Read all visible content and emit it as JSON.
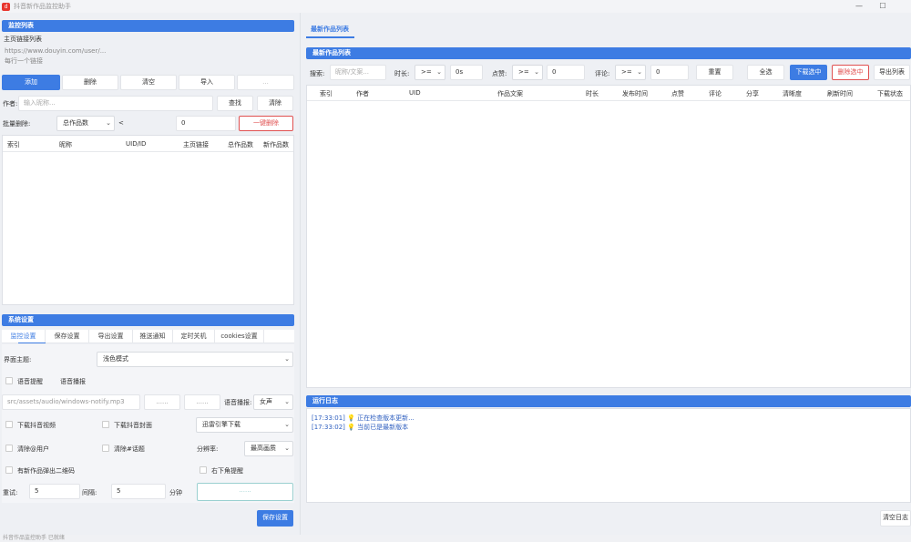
{
  "window": {
    "title": "抖音新作品监控助手",
    "minimize_icon": "minimize-icon",
    "maximize_icon": "maximize-icon"
  },
  "monitor": {
    "header": "监控列表",
    "homepage_label": "主页链接列表",
    "homepage_placeholder_line1": "https://www.douyin.com/user/...",
    "homepage_placeholder_line2": "每行一个链接",
    "buttons": {
      "add": "添加",
      "delete": "删除",
      "clear": "清空",
      "import": "导入",
      "extra": "..."
    },
    "author_label": "作者:",
    "author_placeholder": "输入昵称...",
    "find_button": "查找",
    "clear_button": "清除",
    "batch_label": "批量删除:",
    "batch_select": "总作品数",
    "batch_op": "<",
    "batch_value": "0",
    "batch_delete_button": "一键删除",
    "columns": [
      "索引",
      "昵称",
      "UID/ID",
      "主页链接",
      "总作品数",
      "新作品数"
    ]
  },
  "settings": {
    "header": "系统设置",
    "tabs": [
      "监控设置",
      "保存设置",
      "导出设置",
      "推送通知",
      "定时关机",
      "cookies设置"
    ],
    "theme_label": "界面主题:",
    "theme_value": "浅色模式",
    "voice_alert": "语音提醒",
    "voice_setting": "语音播报",
    "audio_path": "src/assets/audio/windows-notify.mp3",
    "audio_btn1": "......",
    "audio_btn2": "......",
    "voice_label": "语音播报:",
    "voice_value": "女声",
    "download_video": "下载抖音视频",
    "download_cover": "下载抖音封面",
    "engine_value": "迅雷引擎下载",
    "remove_at": "清除@用户",
    "remove_topic": "清除#话题",
    "resolution_label": "分辨率:",
    "resolution_value": "最高画质",
    "qr_popup": "有新作品弹出二维码",
    "corner_popup": "右下角提醒",
    "retry_label": "重试:",
    "retry_value": "5",
    "interval_label": "间隔:",
    "interval_value": "5",
    "minute_label": "分钟",
    "progress_text": "......",
    "save_button": "保存设置"
  },
  "works": {
    "tab": "最新作品列表",
    "header": "最新作品列表",
    "search_label": "搜索:",
    "search_placeholder": "昵称/文案...",
    "duration_label": "时长:",
    "duration_op": ">=",
    "duration_value": "0s",
    "likes_label": "点赞:",
    "likes_op": ">=",
    "likes_value": "0",
    "comments_label": "评论:",
    "comments_op": ">=",
    "comments_value": "0",
    "reset_button": "重置",
    "select_all_button": "全选",
    "download_selected_button": "下载选中",
    "delete_selected_button": "删除选中",
    "export_button": "导出列表",
    "columns": [
      "索引",
      "作者",
      "UID",
      "作品文案",
      "时长",
      "发布时间",
      "点赞",
      "评论",
      "分享",
      "清晰度",
      "刷新时间",
      "下载状态"
    ]
  },
  "log": {
    "header": "运行日志",
    "lines": [
      {
        "time": "[17:33:01]",
        "text": "正在检查版本更新..."
      },
      {
        "time": "[17:33:02]",
        "text": "当前已是最新版本"
      }
    ],
    "clear_button": "清空日志"
  },
  "status_bar": "抖音作品监控助手 已就绪"
}
